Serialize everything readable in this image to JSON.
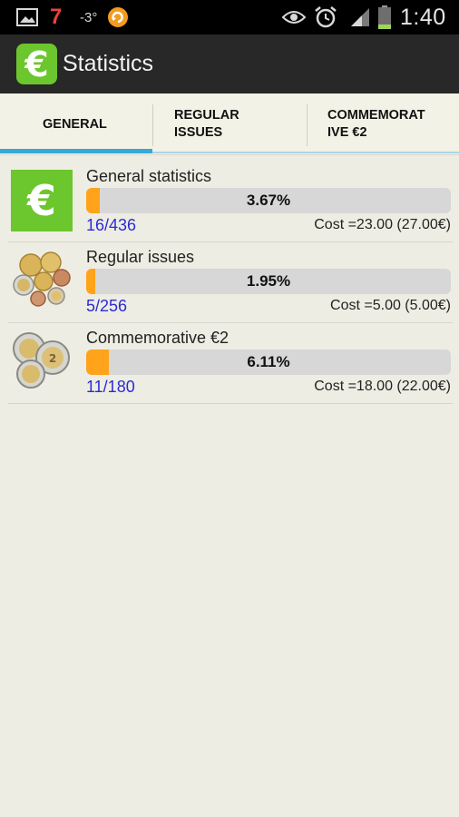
{
  "status_bar": {
    "notification_seven": "7",
    "temperature": "-3°",
    "time": "1:40",
    "icons": [
      "gallery-icon",
      "weather-7-icon",
      "temperature-icon",
      "sync-app-icon",
      "eye-icon",
      "alarm-icon",
      "signal-icon",
      "battery-icon"
    ]
  },
  "action_bar": {
    "app_icon_symbol": "€",
    "title": "Statistics",
    "brand_color": "#6cc62d"
  },
  "tabs": [
    {
      "label": "GENERAL",
      "selected": true
    },
    {
      "label": "REGULAR\nISSUES",
      "selected": false
    },
    {
      "label": "COMMEMORAT\nIVE €2",
      "selected": false
    }
  ],
  "accent_color": "#37a8d9",
  "progress_color": "#ffa31a",
  "stats": [
    {
      "title": "General statistics",
      "percent_label": "3.67%",
      "progress": 0.0367,
      "count": "16/436",
      "cost": "Cost =23.00 (27.00€)",
      "icon": "euro-logo-icon"
    },
    {
      "title": "Regular issues",
      "percent_label": "1.95%",
      "progress": 0.0195,
      "count": "5/256",
      "cost": "Cost =5.00 (5.00€)",
      "icon": "euro-coins-icon"
    },
    {
      "title": "Commemorative €2",
      "percent_label": "6.11%",
      "progress": 0.0611,
      "count": "11/180",
      "cost": "Cost =18.00 (22.00€)",
      "icon": "commemorative-coins-icon"
    }
  ]
}
